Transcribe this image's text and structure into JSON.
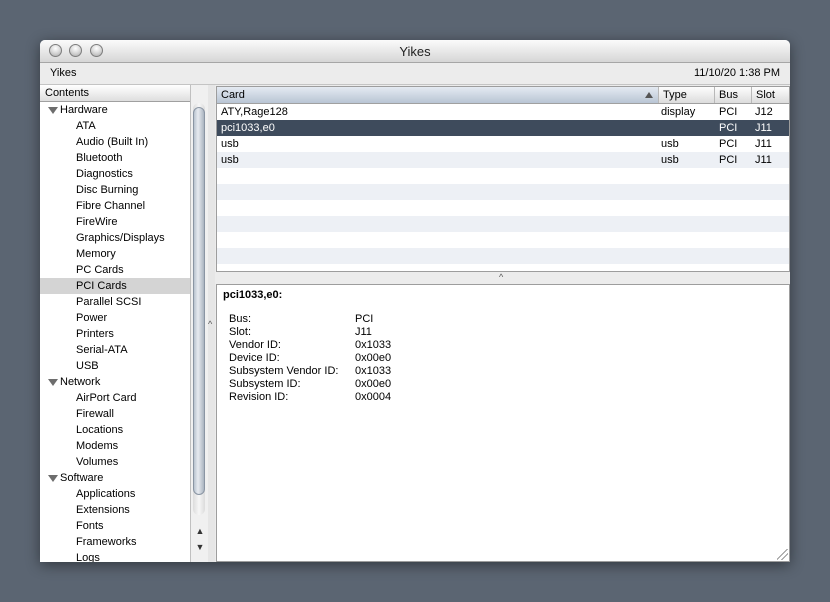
{
  "window": {
    "title": "Yikes",
    "app_name": "Yikes",
    "datetime": "11/10/20 1:38 PM"
  },
  "sidebar": {
    "header": "Contents",
    "items": [
      {
        "label": "Hardware",
        "kind": "group"
      },
      {
        "label": "ATA",
        "kind": "child"
      },
      {
        "label": "Audio (Built In)",
        "kind": "child"
      },
      {
        "label": "Bluetooth",
        "kind": "child"
      },
      {
        "label": "Diagnostics",
        "kind": "child"
      },
      {
        "label": "Disc Burning",
        "kind": "child"
      },
      {
        "label": "Fibre Channel",
        "kind": "child"
      },
      {
        "label": "FireWire",
        "kind": "child"
      },
      {
        "label": "Graphics/Displays",
        "kind": "child"
      },
      {
        "label": "Memory",
        "kind": "child"
      },
      {
        "label": "PC Cards",
        "kind": "child"
      },
      {
        "label": "PCI Cards",
        "kind": "child",
        "selected": true
      },
      {
        "label": "Parallel SCSI",
        "kind": "child"
      },
      {
        "label": "Power",
        "kind": "child"
      },
      {
        "label": "Printers",
        "kind": "child"
      },
      {
        "label": "Serial-ATA",
        "kind": "child"
      },
      {
        "label": "USB",
        "kind": "child"
      },
      {
        "label": "Network",
        "kind": "group"
      },
      {
        "label": "AirPort Card",
        "kind": "child"
      },
      {
        "label": "Firewall",
        "kind": "child"
      },
      {
        "label": "Locations",
        "kind": "child"
      },
      {
        "label": "Modems",
        "kind": "child"
      },
      {
        "label": "Volumes",
        "kind": "child"
      },
      {
        "label": "Software",
        "kind": "group"
      },
      {
        "label": "Applications",
        "kind": "child"
      },
      {
        "label": "Extensions",
        "kind": "child"
      },
      {
        "label": "Fonts",
        "kind": "child"
      },
      {
        "label": "Frameworks",
        "kind": "child"
      },
      {
        "label": "Logs",
        "kind": "child"
      }
    ]
  },
  "table": {
    "columns": [
      "Card",
      "Type",
      "Bus",
      "Slot"
    ],
    "rows": [
      {
        "card": "ATY,Rage128",
        "type": "display",
        "bus": "PCI",
        "slot": "J12"
      },
      {
        "card": "pci1033,e0",
        "type": "",
        "bus": "PCI",
        "slot": "J11",
        "selected": true
      },
      {
        "card": "usb",
        "type": "usb",
        "bus": "PCI",
        "slot": "J11"
      },
      {
        "card": "usb",
        "type": "usb",
        "bus": "PCI",
        "slot": "J11"
      }
    ],
    "empty_rows": 6
  },
  "detail": {
    "title": "pci1033,e0:",
    "properties": [
      {
        "key": "Bus:",
        "value": "PCI"
      },
      {
        "key": "Slot:",
        "value": "J11"
      },
      {
        "key": "Vendor ID:",
        "value": "0x1033"
      },
      {
        "key": "Device ID:",
        "value": "0x00e0"
      },
      {
        "key": "Subsystem Vendor ID:",
        "value": "0x1033"
      },
      {
        "key": "Subsystem ID:",
        "value": "0x00e0"
      },
      {
        "key": "Revision ID:",
        "value": "0x0004"
      }
    ]
  },
  "icons": {
    "splitter_vertical": "^",
    "splitter_horizontal": "^",
    "scroll_up": "▲",
    "scroll_down": "▼"
  }
}
